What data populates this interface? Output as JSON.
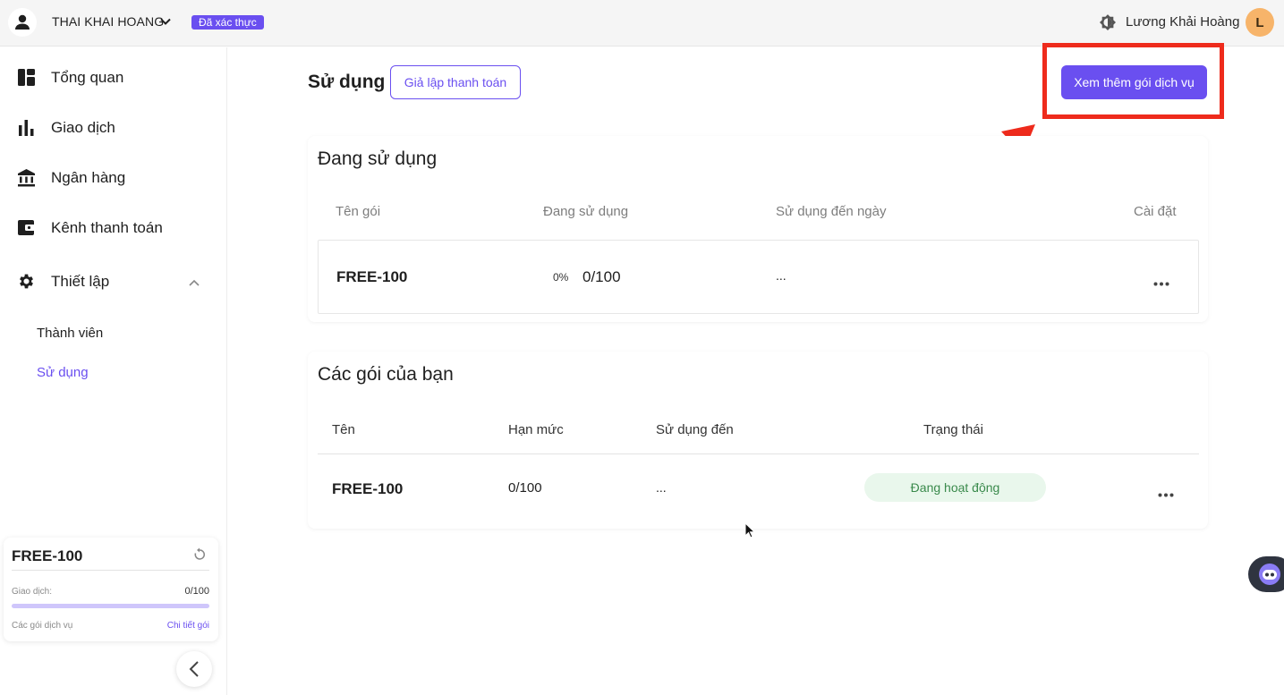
{
  "topbar": {
    "org_name": "THAI KHAI HOANG",
    "verified_badge": "Đã xác thực",
    "user_name": "Lương Khải Hoàng",
    "avatar_letter": "L"
  },
  "sidebar": {
    "items": [
      {
        "label": "Tổng quan",
        "icon": "dashboard-icon"
      },
      {
        "label": "Giao dịch",
        "icon": "bar-chart-icon"
      },
      {
        "label": "Ngân hàng",
        "icon": "bank-icon"
      },
      {
        "label": "Kênh thanh toán",
        "icon": "wallet-icon"
      },
      {
        "label": "Thiết lập",
        "icon": "gear-icon"
      }
    ],
    "sub_items": [
      {
        "label": "Thành viên",
        "active": false
      },
      {
        "label": "Sử dụng",
        "active": true
      }
    ],
    "plan_card": {
      "plan_name": "FREE-100",
      "transactions_label": "Giao dịch:",
      "transactions_value": "0/100",
      "usage_fraction": 0,
      "services_link": "Các gói dịch vụ",
      "detail_link": "Chi tiết gói"
    }
  },
  "main": {
    "title": "Sử dụng",
    "simulate_button": "Giả lập thanh toán",
    "more_plans_button": "Xem thêm gói dịch vụ",
    "in_use": {
      "title": "Đang sử dụng",
      "headers": [
        "Tên gói",
        "Đang sử dụng",
        "Sử dụng đến ngày",
        "Cài đặt"
      ],
      "row": {
        "name": "FREE-100",
        "percent": "0%",
        "usage": "0/100",
        "until": "..."
      }
    },
    "your_plans": {
      "title": "Các gói của bạn",
      "headers": [
        "Tên",
        "Hạn mức",
        "Sử dụng đến",
        "Trạng thái"
      ],
      "row": {
        "name": "FREE-100",
        "limit": "0/100",
        "until": "...",
        "status": "Đang hoạt động"
      }
    }
  },
  "colors": {
    "accent": "#6a4ff0",
    "highlight": "#ee2b1c",
    "status_bg": "#e9f7ec",
    "status_text": "#3a8a4c"
  }
}
